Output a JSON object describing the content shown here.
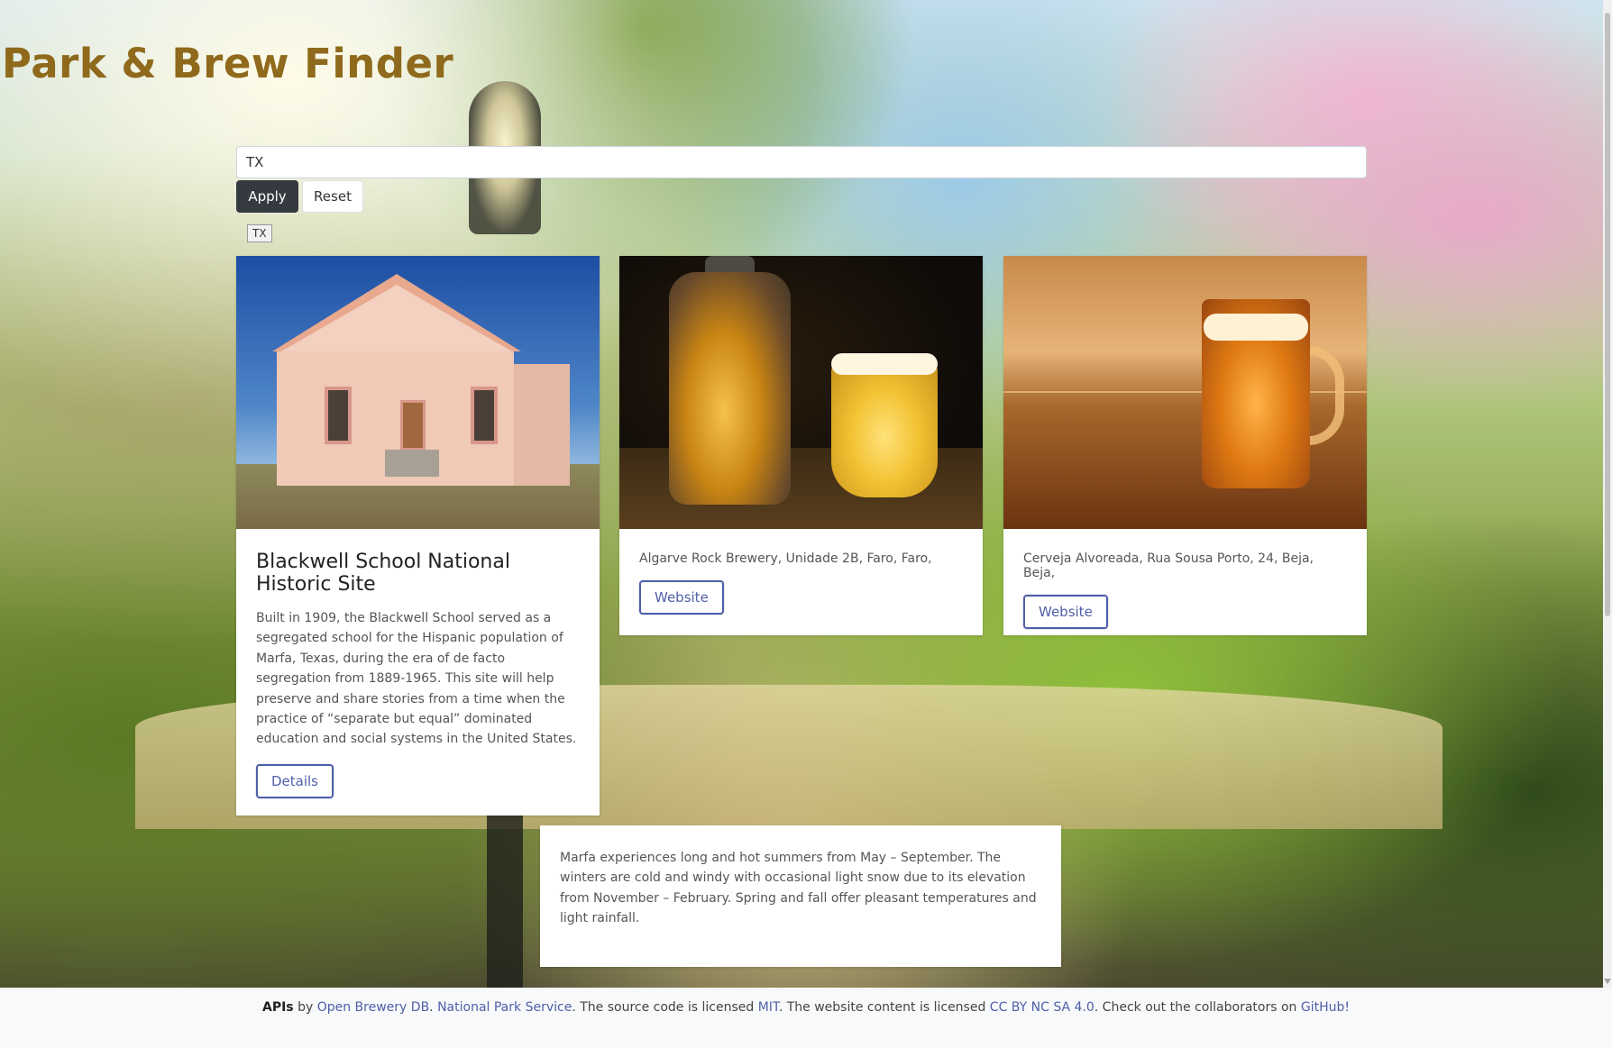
{
  "header": {
    "title": "Park & Brew Finder"
  },
  "search": {
    "value": "TX",
    "placeholder": ""
  },
  "controls": {
    "apply_label": "Apply",
    "reset_label": "Reset",
    "active_tag": "TX"
  },
  "park": {
    "name": "Blackwell School National Historic Site",
    "description": "Built in 1909, the Blackwell School served as a segregated school for the Hispanic population of Marfa, Texas, during the era of de facto segregation from 1889-1965. This site will help preserve and share stories from a time when the practice of “separate but equal” dominated education and social systems in the United States.",
    "details_label": "Details"
  },
  "breweries": [
    {
      "address": "Algarve Rock Brewery, Unidade 2B, Faro, Faro,",
      "website_label": "Website"
    },
    {
      "address": "Cerveja Alvoreada, Rua Sousa Porto, 24, Beja, Beja,",
      "website_label": "Website"
    }
  ],
  "weather": {
    "text": "Marfa experiences long and hot summers from May – September. The winters are cold and windy with occasional light snow due to its elevation from November – February. Spring and fall offer pleasant temperatures and light rainfall."
  },
  "footer": {
    "apis_label": "APIs",
    "by_text": " by ",
    "brewery_link": "Open Brewery DB",
    "sep": ". ",
    "nps_link": "National Park Service",
    "license_text": ". The source code is licensed ",
    "mit_link": "MIT",
    "content_text": ". The website content is licensed ",
    "cc_link": "CC BY NC SA 4.0",
    "collab_text": ". Check out the collaborators on ",
    "github_link": "GitHub!"
  },
  "colors": {
    "title": "#8f6a1c",
    "accent": "#4e5fa8",
    "dark_button": "#343a40"
  }
}
